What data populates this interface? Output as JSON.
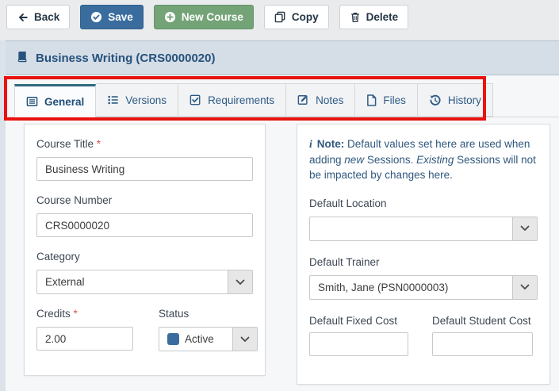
{
  "toolbar": {
    "back_label": "Back",
    "save_label": "Save",
    "new_course_label": "New Course",
    "copy_label": "Copy",
    "delete_label": "Delete"
  },
  "header": {
    "title": "Business Writing (CRS0000020)"
  },
  "tabs": [
    {
      "label": "General",
      "active": true
    },
    {
      "label": "Versions",
      "active": false
    },
    {
      "label": "Requirements",
      "active": false
    },
    {
      "label": "Notes",
      "active": false
    },
    {
      "label": "Files",
      "active": false
    },
    {
      "label": "History",
      "active": false
    }
  ],
  "form": {
    "course_title": {
      "label": "Course Title",
      "required": "*",
      "value": "Business Writing"
    },
    "course_number": {
      "label": "Course Number",
      "value": "CRS0000020"
    },
    "category": {
      "label": "Category",
      "value": "External"
    },
    "credits": {
      "label": "Credits",
      "required": "*",
      "value": "2.00"
    },
    "status": {
      "label": "Status",
      "value": "Active"
    }
  },
  "defaults": {
    "note": {
      "icon": "info-icon",
      "bold": "Note:",
      "seg1": " Default values set here are used when adding ",
      "em1": "new",
      "seg2": " Sessions. ",
      "em2": "Existing",
      "seg3": " Sessions will not be impacted by changes here."
    },
    "location": {
      "label": "Default Location",
      "value": ""
    },
    "trainer": {
      "label": "Default Trainer",
      "value": "Smith, Jane (PSN0000003)"
    },
    "fixed_cost": {
      "label": "Default Fixed Cost",
      "value": ""
    },
    "student_cost": {
      "label": "Default Student Cost",
      "value": ""
    }
  },
  "colors": {
    "accent_blue": "#3a6d9e",
    "accent_green": "#73a376",
    "highlight_red": "#e9120d",
    "active_tab_border": "#2e6b80",
    "status_active_blue": "#3a6d9e",
    "title_bar_bg": "#d5dde7",
    "required_red": "#d9534f"
  },
  "icons": {
    "chevron": "v-chevron-down",
    "info": "i"
  }
}
